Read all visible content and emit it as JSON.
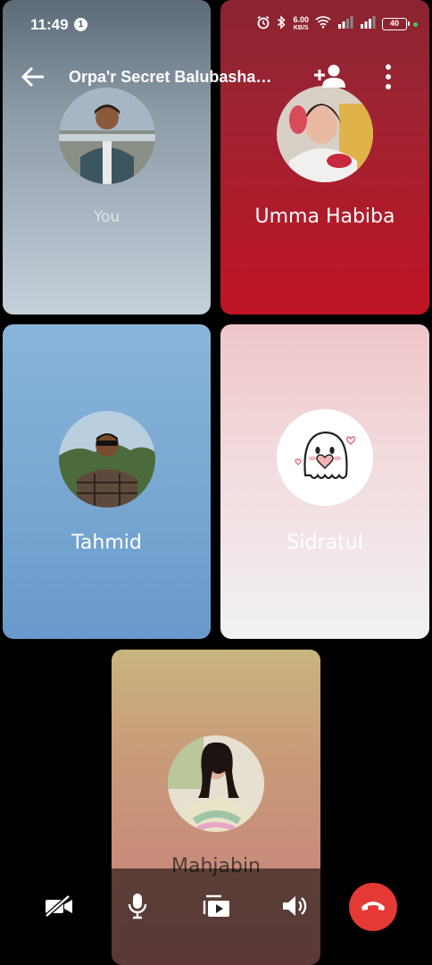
{
  "status_bar": {
    "time": "11:49",
    "notification_count": "1",
    "net_speed": "6.00",
    "net_speed_unit": "KB/S",
    "battery": "40"
  },
  "app_bar": {
    "title": "Orpa'r Secret Balubasha…",
    "back_icon": "arrow-back-icon",
    "add_person_icon": "person-add-icon",
    "more_icon": "more-vert-icon"
  },
  "participants": [
    {
      "name": "You"
    },
    {
      "name": "Umma Habiba"
    },
    {
      "name": "Tahmid"
    },
    {
      "name": "Sidratul"
    },
    {
      "name": "Mahjabin"
    }
  ],
  "controls": {
    "video_icon": "videocam-off-icon",
    "mic_icon": "mic-icon",
    "present_icon": "present-screen-icon",
    "speaker_icon": "volume-up-icon",
    "end_call_icon": "call-end-icon",
    "end_call_color": "#e53935"
  }
}
